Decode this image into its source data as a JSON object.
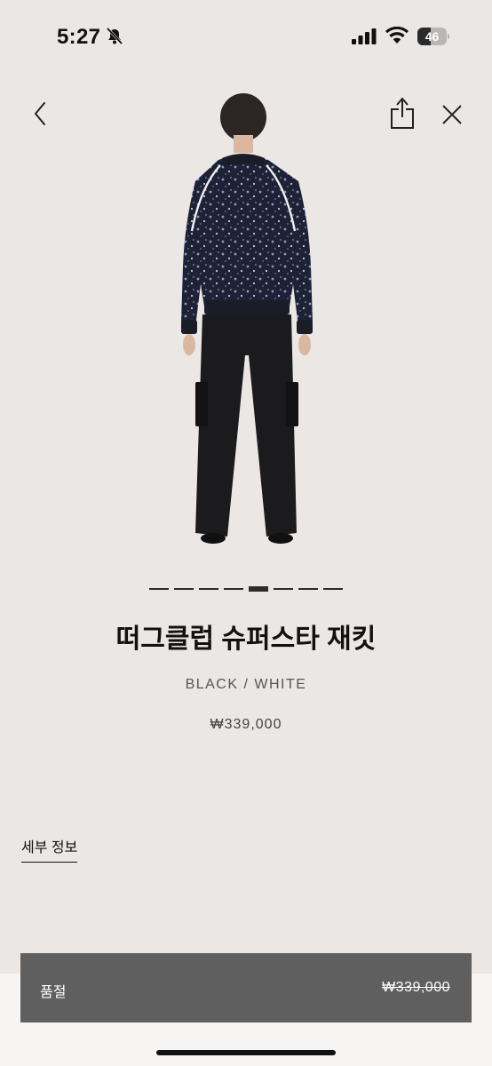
{
  "status_bar": {
    "time": "5:27",
    "battery_level": "46",
    "icons": [
      "bell-slash-icon",
      "signal-icon",
      "wifi-icon",
      "battery-icon"
    ]
  },
  "nav": {
    "icons": [
      "chevron-left-icon",
      "share-icon",
      "close-icon"
    ]
  },
  "carousel": {
    "total": 8,
    "active_index": 4
  },
  "product": {
    "title": "떠그클럽 슈퍼스타 재킷",
    "color": "BLACK / WHITE",
    "price": "₩339,000"
  },
  "tabs": {
    "detail_label": "세부 정보"
  },
  "purchase_bar": {
    "status_label": "품절",
    "price": "₩339,000"
  },
  "colors": {
    "background": "#ebe7e4",
    "soldout_bar": "#5f5f5f"
  }
}
